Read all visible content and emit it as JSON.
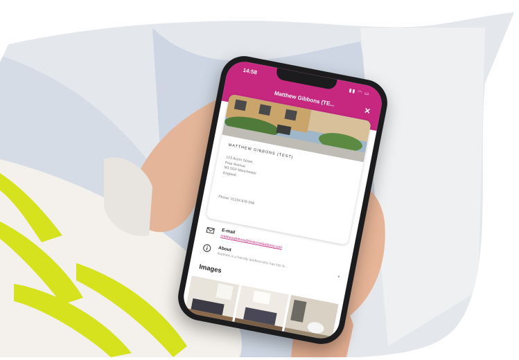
{
  "app": {
    "status_time": "14:58",
    "status_icons": "▮▮ ◠ ▭",
    "title": "Matthew Gibbons (TE...",
    "close_glyph": "✕"
  },
  "agent": {
    "name": "MATTHEW GIBBONS (TEST)",
    "address_lines": [
      "123 Acorn Street",
      "Pear Avenue",
      "M1 5GF Manchester",
      "England"
    ],
    "phone": "Phone: 01234 876 598"
  },
  "contact": {
    "email_label": "E-mail",
    "email_value": "matthewgibbons@testemailaddress.com",
    "about_label": "About",
    "about_value": "Matthew is a friendly landlord who has lots fo..."
  },
  "images": {
    "heading": "Images"
  },
  "colors": {
    "brand": "#c5287e",
    "backdrop": "#e6e9ee",
    "sleeve": "#f3f0ea",
    "stripe": "#d3e21c"
  },
  "icons": [
    "envelope-icon",
    "info-icon",
    "chevron-down-icon",
    "close-icon"
  ]
}
